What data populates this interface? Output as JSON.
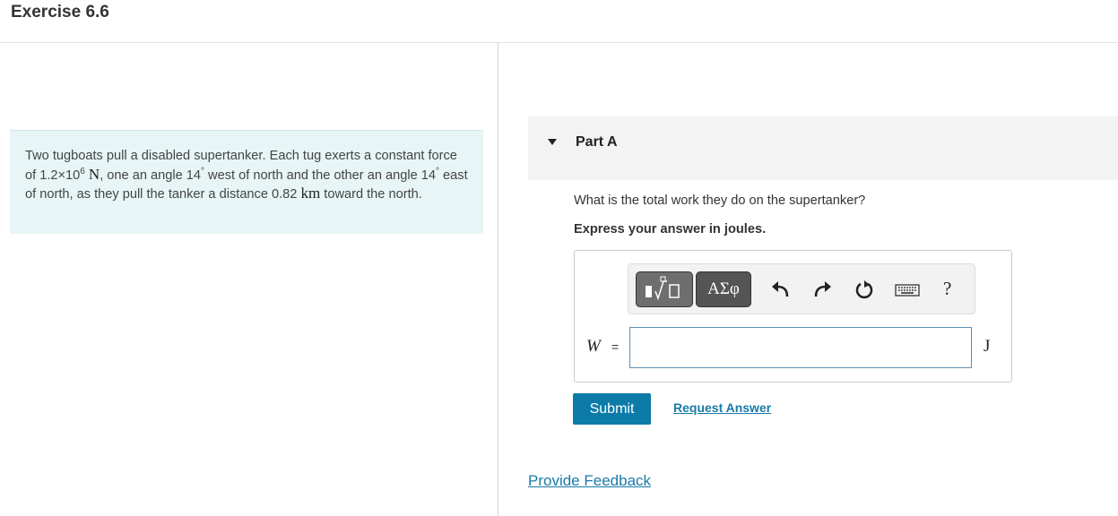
{
  "header": {
    "title": "Exercise 6.6"
  },
  "problem": {
    "p1": "Two tugboats pull a disabled supertanker. Each tug exerts a constant force of 1.2×10",
    "exp": "6",
    "unit_n": "N",
    "p2": ", one an angle 14",
    "deg1": "°",
    "p3": " west of north and the other an angle 14",
    "deg2": "°",
    "p4": " east of north, as they pull the tanker a distance 0.82 ",
    "unit_km": "km",
    "p5": " toward the north."
  },
  "part": {
    "label": "Part A"
  },
  "question": {
    "text": "What is the total work they do on the supertanker?",
    "instruction": "Express your answer in joules."
  },
  "toolbar": {
    "greek_label": "ΑΣφ",
    "help_label": "?",
    "icons": [
      "templates-icon",
      "greek-symbols-icon",
      "undo-icon",
      "redo-icon",
      "reset-icon",
      "keyboard-icon",
      "help-icon"
    ]
  },
  "answer": {
    "variable": "W",
    "equals": "=",
    "value": "",
    "unit": "J"
  },
  "buttons": {
    "submit": "Submit",
    "request": "Request Answer"
  },
  "feedback": {
    "label": "Provide Feedback"
  },
  "colors": {
    "accent": "#0d7ba7",
    "link": "#1a7aa8",
    "problem_bg": "#e7f5f6"
  }
}
